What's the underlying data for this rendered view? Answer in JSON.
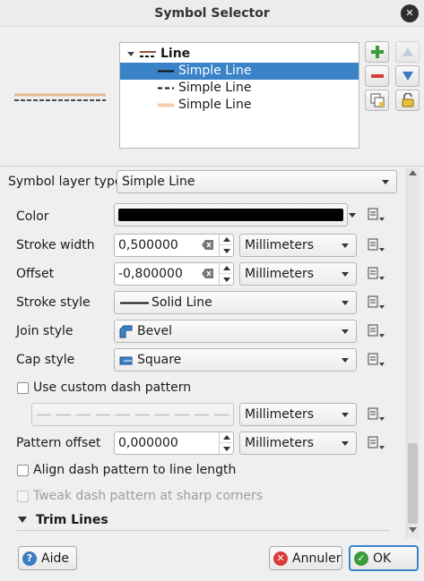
{
  "window": {
    "title": "Symbol Selector",
    "close_glyph": "✕"
  },
  "tree": {
    "root_label": "Line",
    "items": [
      {
        "label": "Simple Line",
        "selected": true
      },
      {
        "label": "Simple Line",
        "selected": false
      },
      {
        "label": "Simple Line",
        "selected": false
      }
    ]
  },
  "form": {
    "symbol_layer_type_label": "Symbol layer type",
    "symbol_layer_type_value": "Simple Line",
    "color_label": "Color",
    "color_value": "#000000",
    "stroke_width_label": "Stroke width",
    "stroke_width_value": "0,500000",
    "stroke_width_unit": "Millimeters",
    "offset_label": "Offset",
    "offset_value": "-0,800000",
    "offset_unit": "Millimeters",
    "stroke_style_label": "Stroke style",
    "stroke_style_value": "Solid Line",
    "join_style_label": "Join style",
    "join_style_value": "Bevel",
    "cap_style_label": "Cap style",
    "cap_style_value": "Square",
    "custom_dash_label": "Use custom dash pattern",
    "dash_unit": "Millimeters",
    "pattern_offset_label": "Pattern offset",
    "pattern_offset_value": "0,000000",
    "pattern_offset_unit": "Millimeters",
    "align_dash_label": "Align dash pattern to line length",
    "tweak_dash_label": "Tweak dash pattern at sharp corners",
    "trim_lines_label": "Trim Lines"
  },
  "buttons": {
    "help": "Aide",
    "cancel": "Annuler",
    "ok": "OK"
  },
  "colors": {
    "selection": "#3a83c8",
    "accent_green": "#3b9a3b",
    "accent_red": "#d93b3b"
  }
}
